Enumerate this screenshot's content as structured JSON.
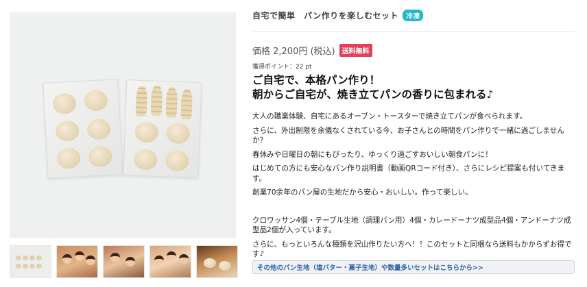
{
  "product": {
    "title": "自宅で簡単　パン作りを楽しむセット",
    "badge": "冷凍",
    "price": "価格 2,200円 (税込)",
    "free_shipping": "送料無料",
    "points": "獲得ポイント：22 pt"
  },
  "headline": {
    "line1": "ご自宅で、本格パン作り！",
    "line2": "朝からご自宅が、焼き立てパンの香りに包まれる♪"
  },
  "description": [
    "大人の職業体験、自宅にあるオーブン・トースターで焼き立てパンが食べられます。",
    "さらに、外出制限を余儀なくされている今、お子さんとの時間をパン作りで一緒に過ごしませんか？",
    "春休みや日曜日の朝にもぴったり、ゆっくり過ごすおいしい朝食パンに！",
    "はじめての方にも安心なパン作り説明書（動画QRコード付き）、さらにレシピ提案も付いてきます。",
    "創業70余年のパン屋の生地だから安心・おいしい。作って楽しい。",
    "クロワッサン4個・テーブル生地（調理パン用）4個・カレードーナツ成型品4個・アンドーナツ成型品2個が入っています。",
    "さらに、もっといろんな種類を沢山作りたい方へ！！このセットと同梱なら送料もかからずお得です♪"
  ],
  "more_link": "その他のパン生地（塩バター・菓子生地）や数量多いセットはこちらから>>",
  "gallery": {
    "main_image": "bread-dough-set-photo",
    "thumbnails": [
      "dough-bags",
      "kids-baking-1",
      "kids-baking-2",
      "kids-baking-3",
      "baked-bread"
    ]
  }
}
